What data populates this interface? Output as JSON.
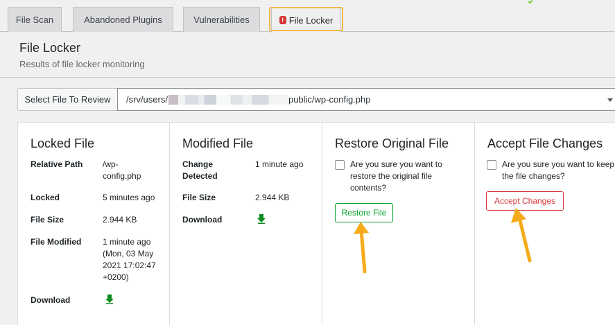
{
  "tabs": [
    {
      "label": "File Scan"
    },
    {
      "label": "Abandoned Plugins"
    },
    {
      "label": "Vulnerabilities"
    },
    {
      "label": "File Locker",
      "active": true,
      "icon": "warning-icon",
      "icon_glyph": "!"
    }
  ],
  "header": {
    "title": "File Locker",
    "subtitle": "Results of file locker monitoring"
  },
  "file_select": {
    "label": "Select File To Review",
    "path_prefix": "/srv/users/",
    "path_suffix": "public/wp-config.php"
  },
  "locked_file": {
    "title": "Locked File",
    "relative_path_label": "Relative Path",
    "relative_path_value": "/wp-config.php",
    "locked_label": "Locked",
    "locked_value": "5 minutes ago",
    "file_size_label": "File Size",
    "file_size_value": "2.944 KB",
    "file_modified_label": "File Modified",
    "file_modified_value": "1 minute ago (Mon, 03 May 2021 17:02:47 +0200)",
    "download_label": "Download"
  },
  "modified_file": {
    "title": "Modified File",
    "change_detected_label": "Change Detected",
    "change_detected_value": "1 minute ago",
    "file_size_label": "File Size",
    "file_size_value": "2.944 KB",
    "download_label": "Download"
  },
  "restore": {
    "title": "Restore Original File",
    "confirm_text": "Are you sure you want to restore the original file contents?",
    "button_label": "Restore File"
  },
  "accept": {
    "title": "Accept File Changes",
    "confirm_text": "Are you sure you want to keep the file changes?",
    "button_label": "Accept Changes"
  },
  "colors": {
    "accent_green": "#00a32a",
    "accent_red": "#d63638",
    "highlight_orange": "#f0b849",
    "annotation_arrow": "#f5ab1b"
  }
}
